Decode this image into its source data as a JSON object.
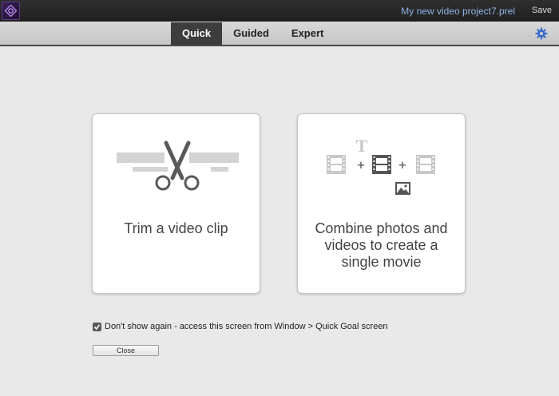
{
  "titlebar": {
    "project_name": "My new video project7.prel",
    "save_label": "Save"
  },
  "tabs": [
    {
      "label": "Quick",
      "active": true
    },
    {
      "label": "Guided",
      "active": false
    },
    {
      "label": "Expert",
      "active": false
    }
  ],
  "cards": {
    "trim": {
      "label": "Trim a video clip",
      "icon": "scissors-icon"
    },
    "combine": {
      "label": "Combine photos and videos to create a single movie",
      "icon": "combine-media-icon"
    }
  },
  "footer": {
    "dont_show_label": "Don't show again - access this screen from Window > Quick Goal screen",
    "dont_show_checked": true,
    "close_label": "Close"
  },
  "colors": {
    "accent_link": "#8fb3e6",
    "active_tab": "#3d3d3d",
    "gear": "#3a6cc8"
  }
}
